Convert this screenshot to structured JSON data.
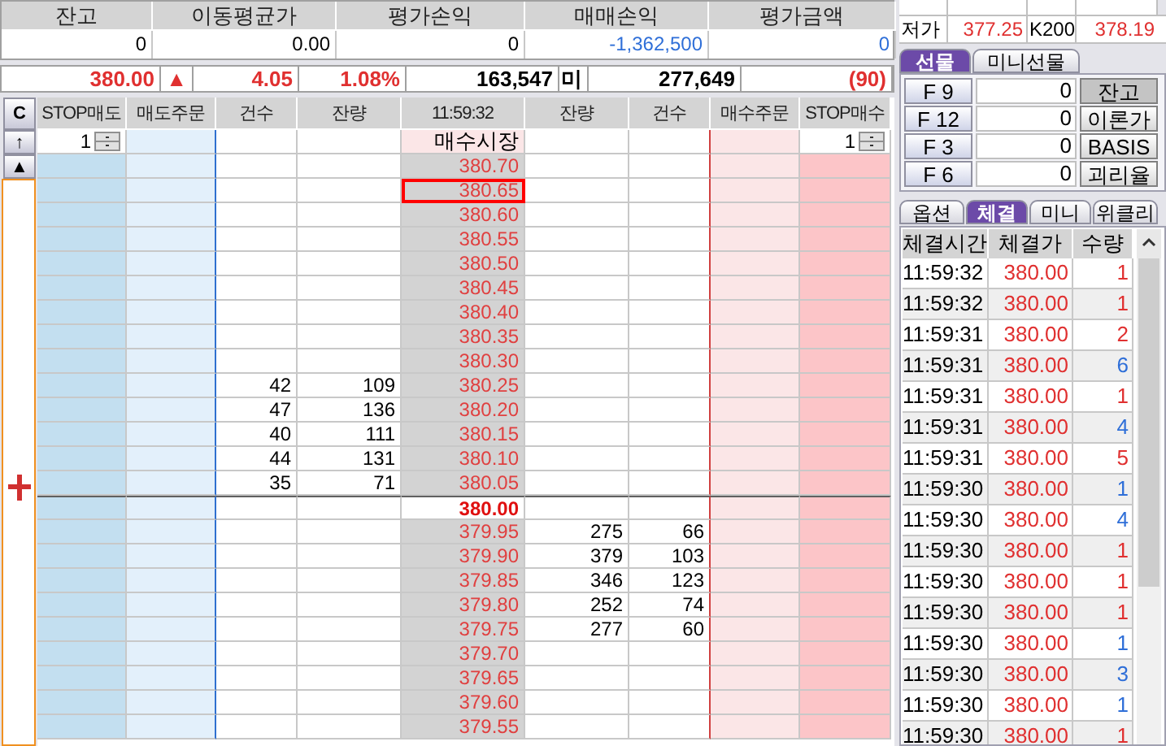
{
  "summary": {
    "columns": [
      "잔고",
      "이동평균가",
      "평가손익",
      "매매손익",
      "평가금액"
    ],
    "values": [
      {
        "text": "0",
        "kind": "plain"
      },
      {
        "text": "0.00",
        "kind": "plain"
      },
      {
        "text": "0",
        "kind": "plain"
      },
      {
        "text": "-1,362,500",
        "kind": "down"
      },
      {
        "text": "0",
        "kind": "down"
      }
    ]
  },
  "quote": {
    "price": "380.00",
    "arrow": "▲",
    "change": "4.05",
    "rate": "1.08%",
    "volume": "163,547",
    "oi_label": "미",
    "open_interest": "277,649",
    "oi_change": "(90)"
  },
  "order_book": {
    "side_buttons": [
      "C",
      "↑",
      "▲"
    ],
    "columns": [
      "STOP매도",
      "매도주문",
      "건수",
      "잔량",
      "11:59:32",
      "잔량",
      "건수",
      "매수주문",
      "STOP매수"
    ],
    "stop_sell_qty": "1",
    "stop_buy_qty": "1",
    "market_label": "매수시장",
    "rows": [
      {
        "price": "380.70",
        "marked": false,
        "current": false
      },
      {
        "price": "380.65",
        "marked": true,
        "current": false
      },
      {
        "price": "380.60",
        "marked": false,
        "current": false
      },
      {
        "price": "380.55",
        "marked": false,
        "current": false
      },
      {
        "price": "380.50",
        "marked": false,
        "current": false
      },
      {
        "price": "380.45",
        "marked": false,
        "current": false
      },
      {
        "price": "380.40",
        "marked": false,
        "current": false
      },
      {
        "price": "380.35",
        "marked": false,
        "current": false
      },
      {
        "price": "380.30",
        "marked": false,
        "current": false
      },
      {
        "price": "380.25",
        "sell_count": "42",
        "sell_qty": "109",
        "marked": false,
        "current": false
      },
      {
        "price": "380.20",
        "sell_count": "47",
        "sell_qty": "136",
        "marked": false,
        "current": false
      },
      {
        "price": "380.15",
        "sell_count": "40",
        "sell_qty": "111",
        "marked": false,
        "current": false
      },
      {
        "price": "380.10",
        "sell_count": "44",
        "sell_qty": "131",
        "marked": false,
        "current": false
      },
      {
        "price": "380.05",
        "sell_count": "35",
        "sell_qty": "71",
        "marked": false,
        "current": false
      },
      {
        "price": "380.00",
        "marked": false,
        "current": true
      },
      {
        "price": "379.95",
        "buy_qty": "275",
        "buy_count": "66",
        "marked": false,
        "current": false
      },
      {
        "price": "379.90",
        "buy_qty": "379",
        "buy_count": "103",
        "marked": false,
        "current": false
      },
      {
        "price": "379.85",
        "buy_qty": "346",
        "buy_count": "123",
        "marked": false,
        "current": false
      },
      {
        "price": "379.80",
        "buy_qty": "252",
        "buy_count": "74",
        "marked": false,
        "current": false
      },
      {
        "price": "379.75",
        "buy_qty": "277",
        "buy_count": "60",
        "marked": false,
        "current": false
      },
      {
        "price": "379.70",
        "marked": false,
        "current": false
      },
      {
        "price": "379.65",
        "marked": false,
        "current": false
      },
      {
        "price": "379.60",
        "marked": false,
        "current": false
      },
      {
        "price": "379.55",
        "marked": false,
        "current": false
      }
    ]
  },
  "side_panel": {
    "low_label": "저가",
    "low": "377.25",
    "index_label": "K200",
    "index": "378.19",
    "tabs": [
      {
        "label": "선물",
        "selected": true
      },
      {
        "label": "미니선물",
        "selected": false
      }
    ],
    "futures": [
      {
        "code": "F 9",
        "value": "0",
        "button": "잔고",
        "selected": true
      },
      {
        "code": "F 12",
        "value": "0",
        "button": "이론가",
        "selected": false
      },
      {
        "code": "F 3",
        "value": "0",
        "button": "BASIS",
        "selected": false
      },
      {
        "code": "F 6",
        "value": "0",
        "button": "괴리율",
        "selected": false
      }
    ],
    "trade_tabs": [
      {
        "label": "옵션",
        "selected": false
      },
      {
        "label": "체결",
        "selected": true
      },
      {
        "label": "미니",
        "selected": false
      },
      {
        "label": "위클리",
        "selected": false
      }
    ],
    "trades": {
      "columns": [
        "체결시간",
        "체결가",
        "수량"
      ],
      "rows": [
        {
          "time": "11:59:32",
          "price": "380.00",
          "qty": "1",
          "color": "#e03030"
        },
        {
          "time": "11:59:32",
          "price": "380.00",
          "qty": "1",
          "color": "#e03030"
        },
        {
          "time": "11:59:31",
          "price": "380.00",
          "qty": "2",
          "color": "#e03030"
        },
        {
          "time": "11:59:31",
          "price": "380.00",
          "qty": "6",
          "color": "#2f6fd8"
        },
        {
          "time": "11:59:31",
          "price": "380.00",
          "qty": "1",
          "color": "#e03030"
        },
        {
          "time": "11:59:31",
          "price": "380.00",
          "qty": "4",
          "color": "#2f6fd8"
        },
        {
          "time": "11:59:31",
          "price": "380.00",
          "qty": "5",
          "color": "#e03030"
        },
        {
          "time": "11:59:30",
          "price": "380.00",
          "qty": "1",
          "color": "#2f6fd8"
        },
        {
          "time": "11:59:30",
          "price": "380.00",
          "qty": "4",
          "color": "#2f6fd8"
        },
        {
          "time": "11:59:30",
          "price": "380.00",
          "qty": "1",
          "color": "#e03030"
        },
        {
          "time": "11:59:30",
          "price": "380.00",
          "qty": "1",
          "color": "#e03030"
        },
        {
          "time": "11:59:30",
          "price": "380.00",
          "qty": "1",
          "color": "#e03030"
        },
        {
          "time": "11:59:30",
          "price": "380.00",
          "qty": "1",
          "color": "#2f6fd8"
        },
        {
          "time": "11:59:30",
          "price": "380.00",
          "qty": "3",
          "color": "#2f6fd8"
        },
        {
          "time": "11:59:30",
          "price": "380.00",
          "qty": "1",
          "color": "#2f6fd8"
        },
        {
          "time": "11:59:30",
          "price": "380.00",
          "qty": "1",
          "color": "#e03030"
        }
      ]
    }
  }
}
